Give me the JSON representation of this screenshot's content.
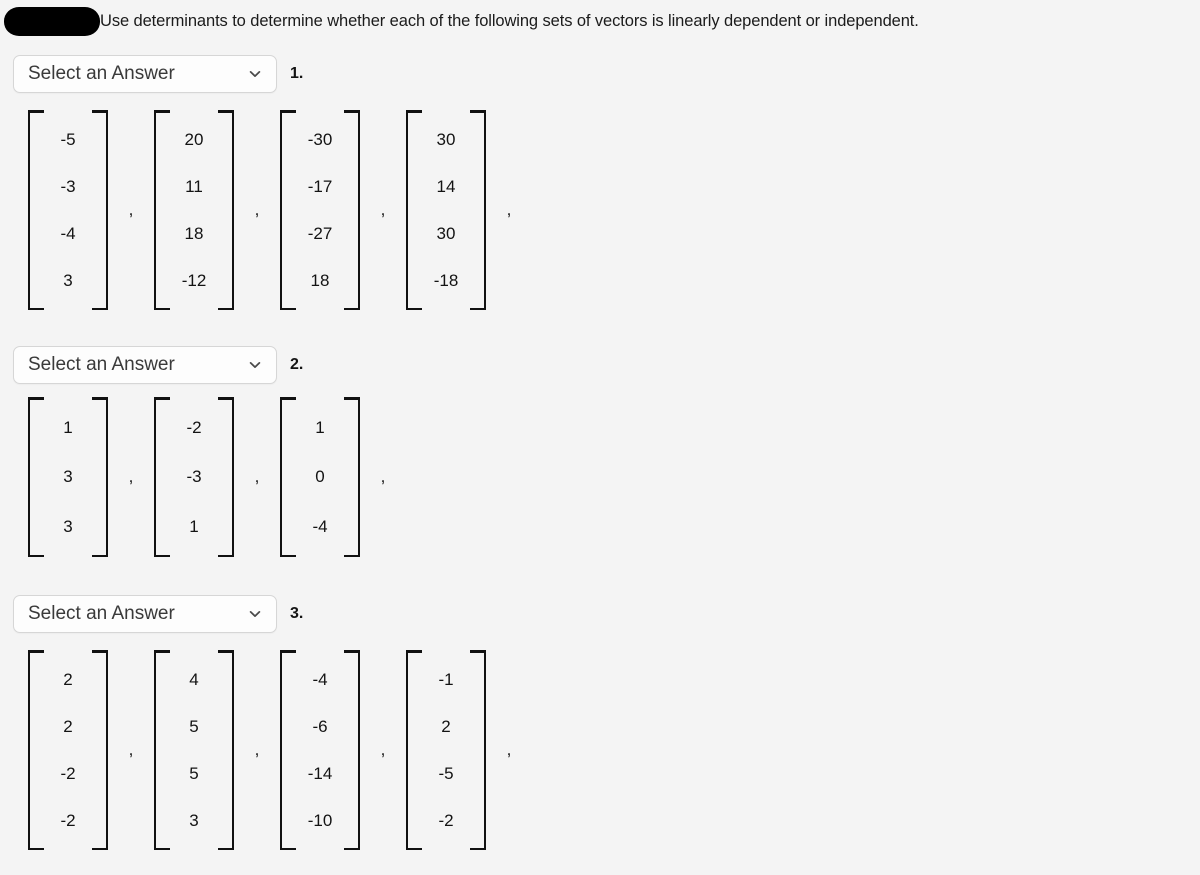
{
  "page": {
    "background_color": "#f4f4f4",
    "text_color": "#131313"
  },
  "header": {
    "redaction": "redacted-black-bar",
    "prompt": "Use determinants to determine whether each of the following sets of vectors is linearly dependent or independent."
  },
  "select_defaults": {
    "placeholder": "Select an Answer",
    "chevron_icon": "chevron-down-icon"
  },
  "questions": [
    {
      "number": "1.",
      "answer": {
        "label": "Select an Answer",
        "selected": "Select an Answer"
      },
      "vectors": [
        {
          "entries": [
            "-5",
            "-3",
            "-4",
            "3"
          ]
        },
        {
          "entries": [
            "20",
            "11",
            "18",
            "-12"
          ]
        },
        {
          "entries": [
            "-30",
            "-17",
            "-27",
            "18"
          ]
        },
        {
          "entries": [
            "30",
            "14",
            "30",
            "-18"
          ]
        }
      ],
      "separator": ",",
      "trailing_separator": ","
    },
    {
      "number": "2.",
      "answer": {
        "label": "Select an Answer",
        "selected": "Select an Answer"
      },
      "vectors": [
        {
          "entries": [
            "1",
            "3",
            "3"
          ]
        },
        {
          "entries": [
            "-2",
            "-3",
            "1"
          ]
        },
        {
          "entries": [
            "1",
            "0",
            "-4"
          ]
        }
      ],
      "separator": ",",
      "trailing_separator": ","
    },
    {
      "number": "3.",
      "answer": {
        "label": "Select an Answer",
        "selected": "Select an Answer"
      },
      "vectors": [
        {
          "entries": [
            "2",
            "2",
            "-2",
            "-2"
          ]
        },
        {
          "entries": [
            "4",
            "5",
            "5",
            "3"
          ]
        },
        {
          "entries": [
            "-4",
            "-6",
            "-14",
            "-10"
          ]
        },
        {
          "entries": [
            "-1",
            "2",
            "-5",
            "-2"
          ]
        }
      ],
      "separator": ",",
      "trailing_separator": ","
    }
  ]
}
